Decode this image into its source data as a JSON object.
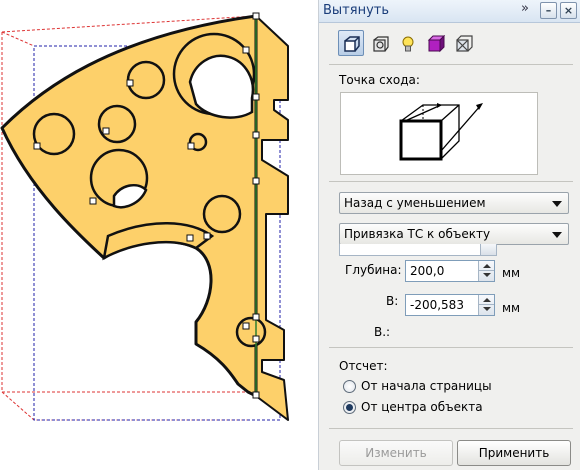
{
  "docker": {
    "title": "Вытянуть",
    "title_buttons": [
      "chevron-double-right-icon",
      "minimize-icon",
      "close-icon"
    ],
    "toolbar": [
      {
        "icon": "extrude-camera-icon",
        "active": true
      },
      {
        "icon": "extrude-rotation-icon",
        "active": false
      },
      {
        "icon": "extrude-lighting-icon",
        "active": false
      },
      {
        "icon": "extrude-color-icon",
        "active": false
      },
      {
        "icon": "extrude-bevel-icon",
        "active": false
      }
    ],
    "vanishing_point_label": "Точка схода:",
    "extrude_type": "Назад с уменьшением",
    "vp_locked": "Привязка ТС к объекту",
    "depth_label": "Глубина:",
    "depth_value": "200,0",
    "depth_unit": "мм",
    "h_label": "В:",
    "h_value": "-200,583",
    "h_unit": "мм",
    "v_label": "В.:",
    "origin_label": "Отсчет:",
    "origin_options": [
      {
        "label": "От начала страницы",
        "selected": false
      },
      {
        "label": "От центра объекта",
        "selected": true
      }
    ],
    "edit_button": "Изменить",
    "apply_button": "Применить"
  },
  "colors": {
    "cheese_fill": "#fdd06a",
    "selection_red": "#d33",
    "selection_blue": "#22a",
    "accent": "#1a3d7a"
  }
}
